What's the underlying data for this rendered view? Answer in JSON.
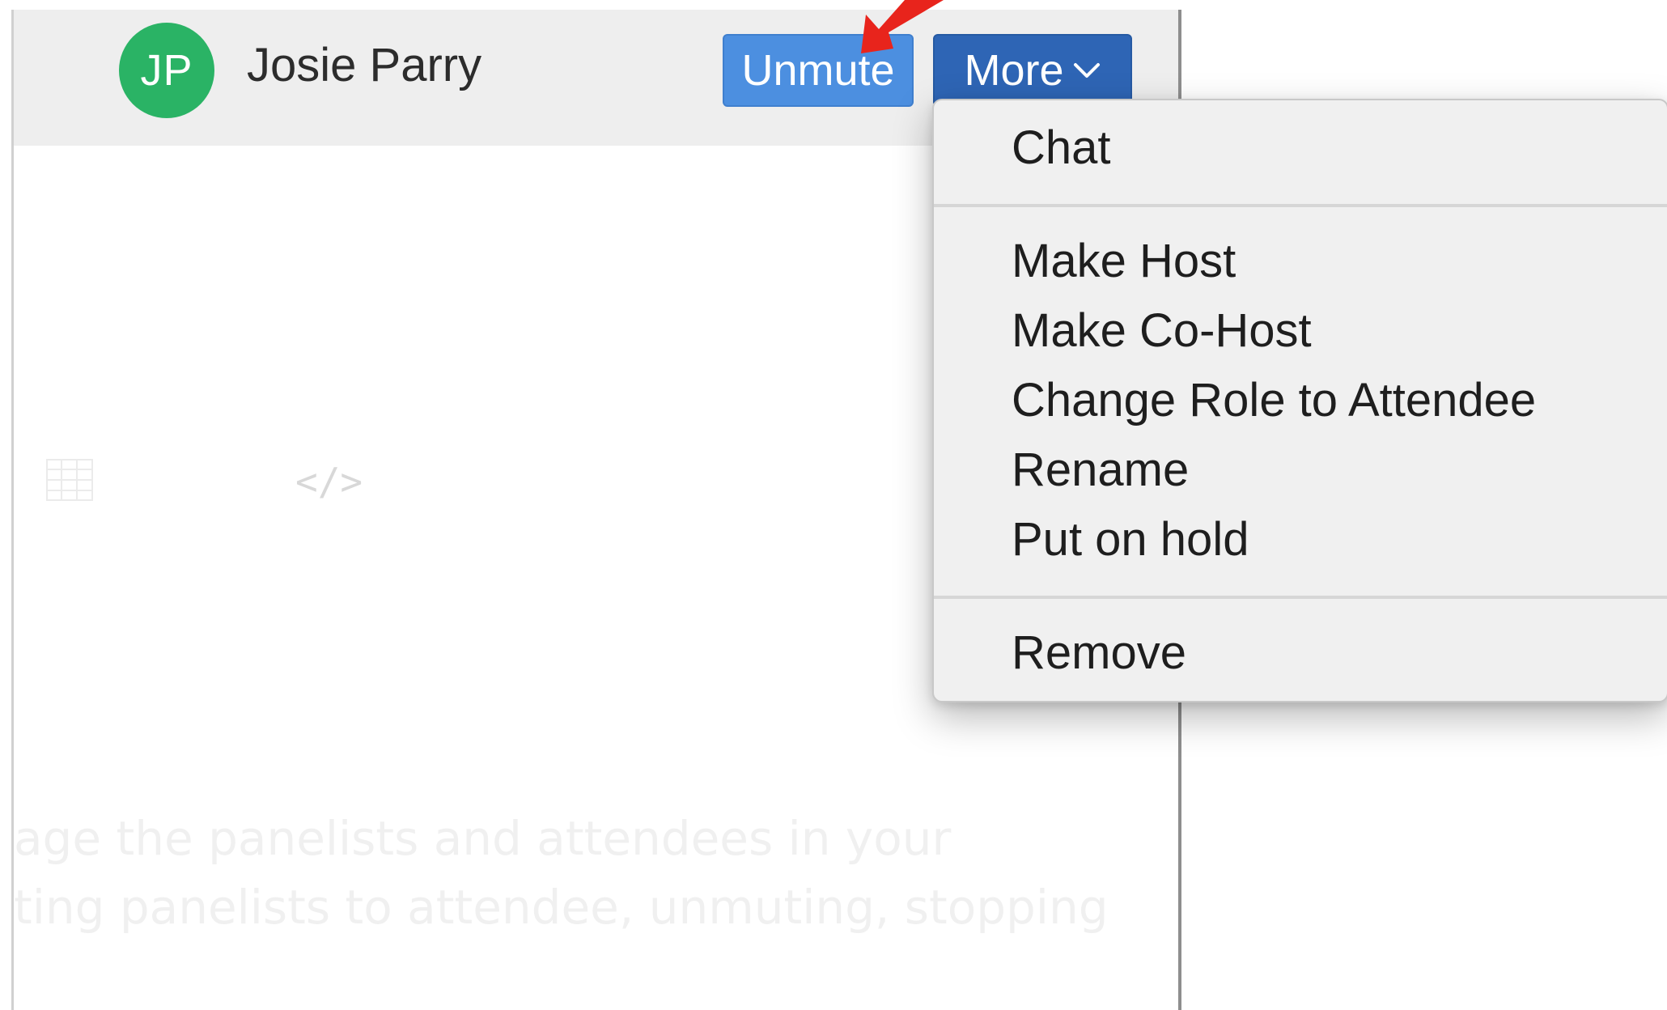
{
  "participant": {
    "initials": "JP",
    "name": "Josie Parry",
    "avatar_color": "#2ab365"
  },
  "buttons": {
    "unmute_label": "Unmute",
    "more_label": "More"
  },
  "menu": {
    "items": [
      "Chat",
      "Make Host",
      "Make Co-Host",
      "Change Role to Attendee",
      "Rename",
      "Put on hold",
      "Remove"
    ]
  },
  "background_text": {
    "line1": "age the panelists and attendees in your",
    "line2": "ting panelists to attendee, unmuting, stopping",
    "code_icon": "</>"
  },
  "colors": {
    "unmute": "#4c8fe0",
    "more": "#2e65b5",
    "pointer": "#e8241c"
  }
}
